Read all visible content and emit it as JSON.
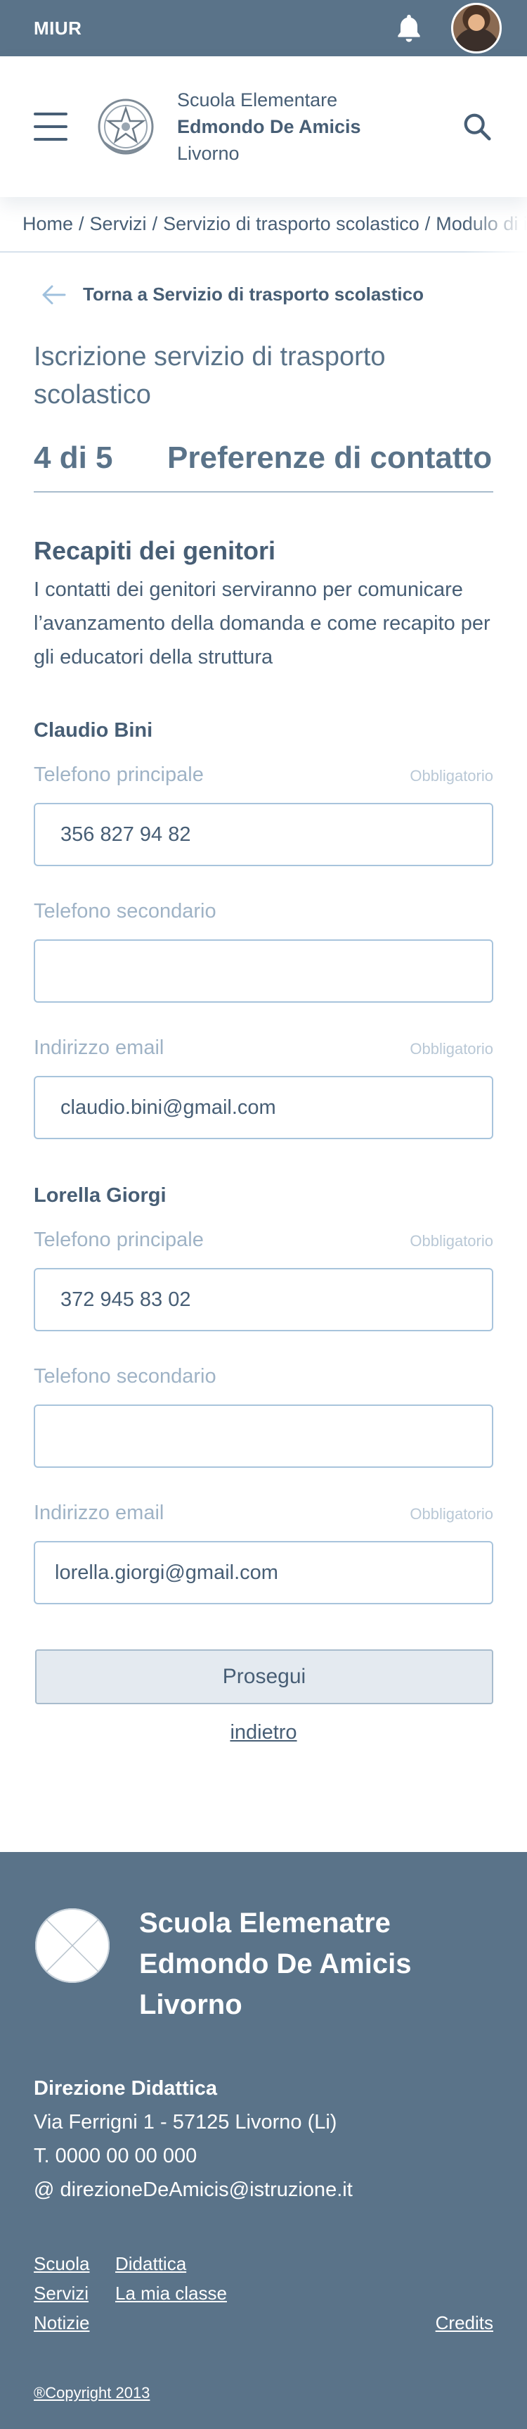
{
  "topbar": {
    "org": "MIUR",
    "icons": [
      "bell-icon",
      "user-avatar"
    ]
  },
  "header": {
    "school_line1": "Scuola Elementare",
    "school_line2": "Edmondo De Amicis",
    "school_line3": "Livorno",
    "icons": [
      "menu-icon",
      "emblem-logo",
      "search-icon"
    ]
  },
  "breadcrumb": [
    "Home",
    "Servizi",
    "Servizio di trasporto scolastico",
    "Modulo di iscrizione"
  ],
  "back_link": "Torna a Servizio di trasporto scolastico",
  "page_title": "Iscrizione servizio di trasporto scolastico",
  "step": {
    "count": "4 di 5",
    "title": "Preferenze di contatto"
  },
  "section": {
    "title": "Recapiti dei genitori",
    "description": "I contatti dei genitori serviranno per comunicare l’avanzamento della domanda e come recapito per gli educatori della struttura"
  },
  "labels": {
    "phone_primary": "Telefono principale",
    "phone_secondary": "Telefono secondario",
    "email": "Indirizzo email",
    "required": "Obbligatorio"
  },
  "parents": [
    {
      "name": "Claudio Bini",
      "phone_primary": "356 827 94 82",
      "phone_secondary": "",
      "email": "claudio.bini@gmail.com"
    },
    {
      "name": "Lorella Giorgi",
      "phone_primary": "372 945 83 02",
      "phone_secondary": "",
      "email": "lorella.giorgi@gmail.com"
    }
  ],
  "actions": {
    "continue": "Prosegui",
    "back": "indietro"
  },
  "footer": {
    "name_line1": "Scuola Elemenatre",
    "name_line2": "Edmondo De Amicis",
    "name_line3": "Livorno",
    "contact_title": "Direzione Didattica",
    "address": "Via Ferrigni 1 - 57125 Livorno (Li)",
    "phone": "T. 0000 00 00 000",
    "email": "@ direzioneDeAmicis@istruzione.it",
    "links": {
      "scuola": "Scuola",
      "didattica": "Didattica",
      "servizi": "Servizi",
      "mia_classe": "La mia classe",
      "notizie": "Notizie",
      "credits": "Credits"
    },
    "copyright": "®Copyright 2013"
  },
  "colors": {
    "primary": "#5a7389",
    "text": "#475e75",
    "muted": "#9fb3c6",
    "input_border": "#a8c4dc",
    "button_bg": "#e4eaf0"
  }
}
